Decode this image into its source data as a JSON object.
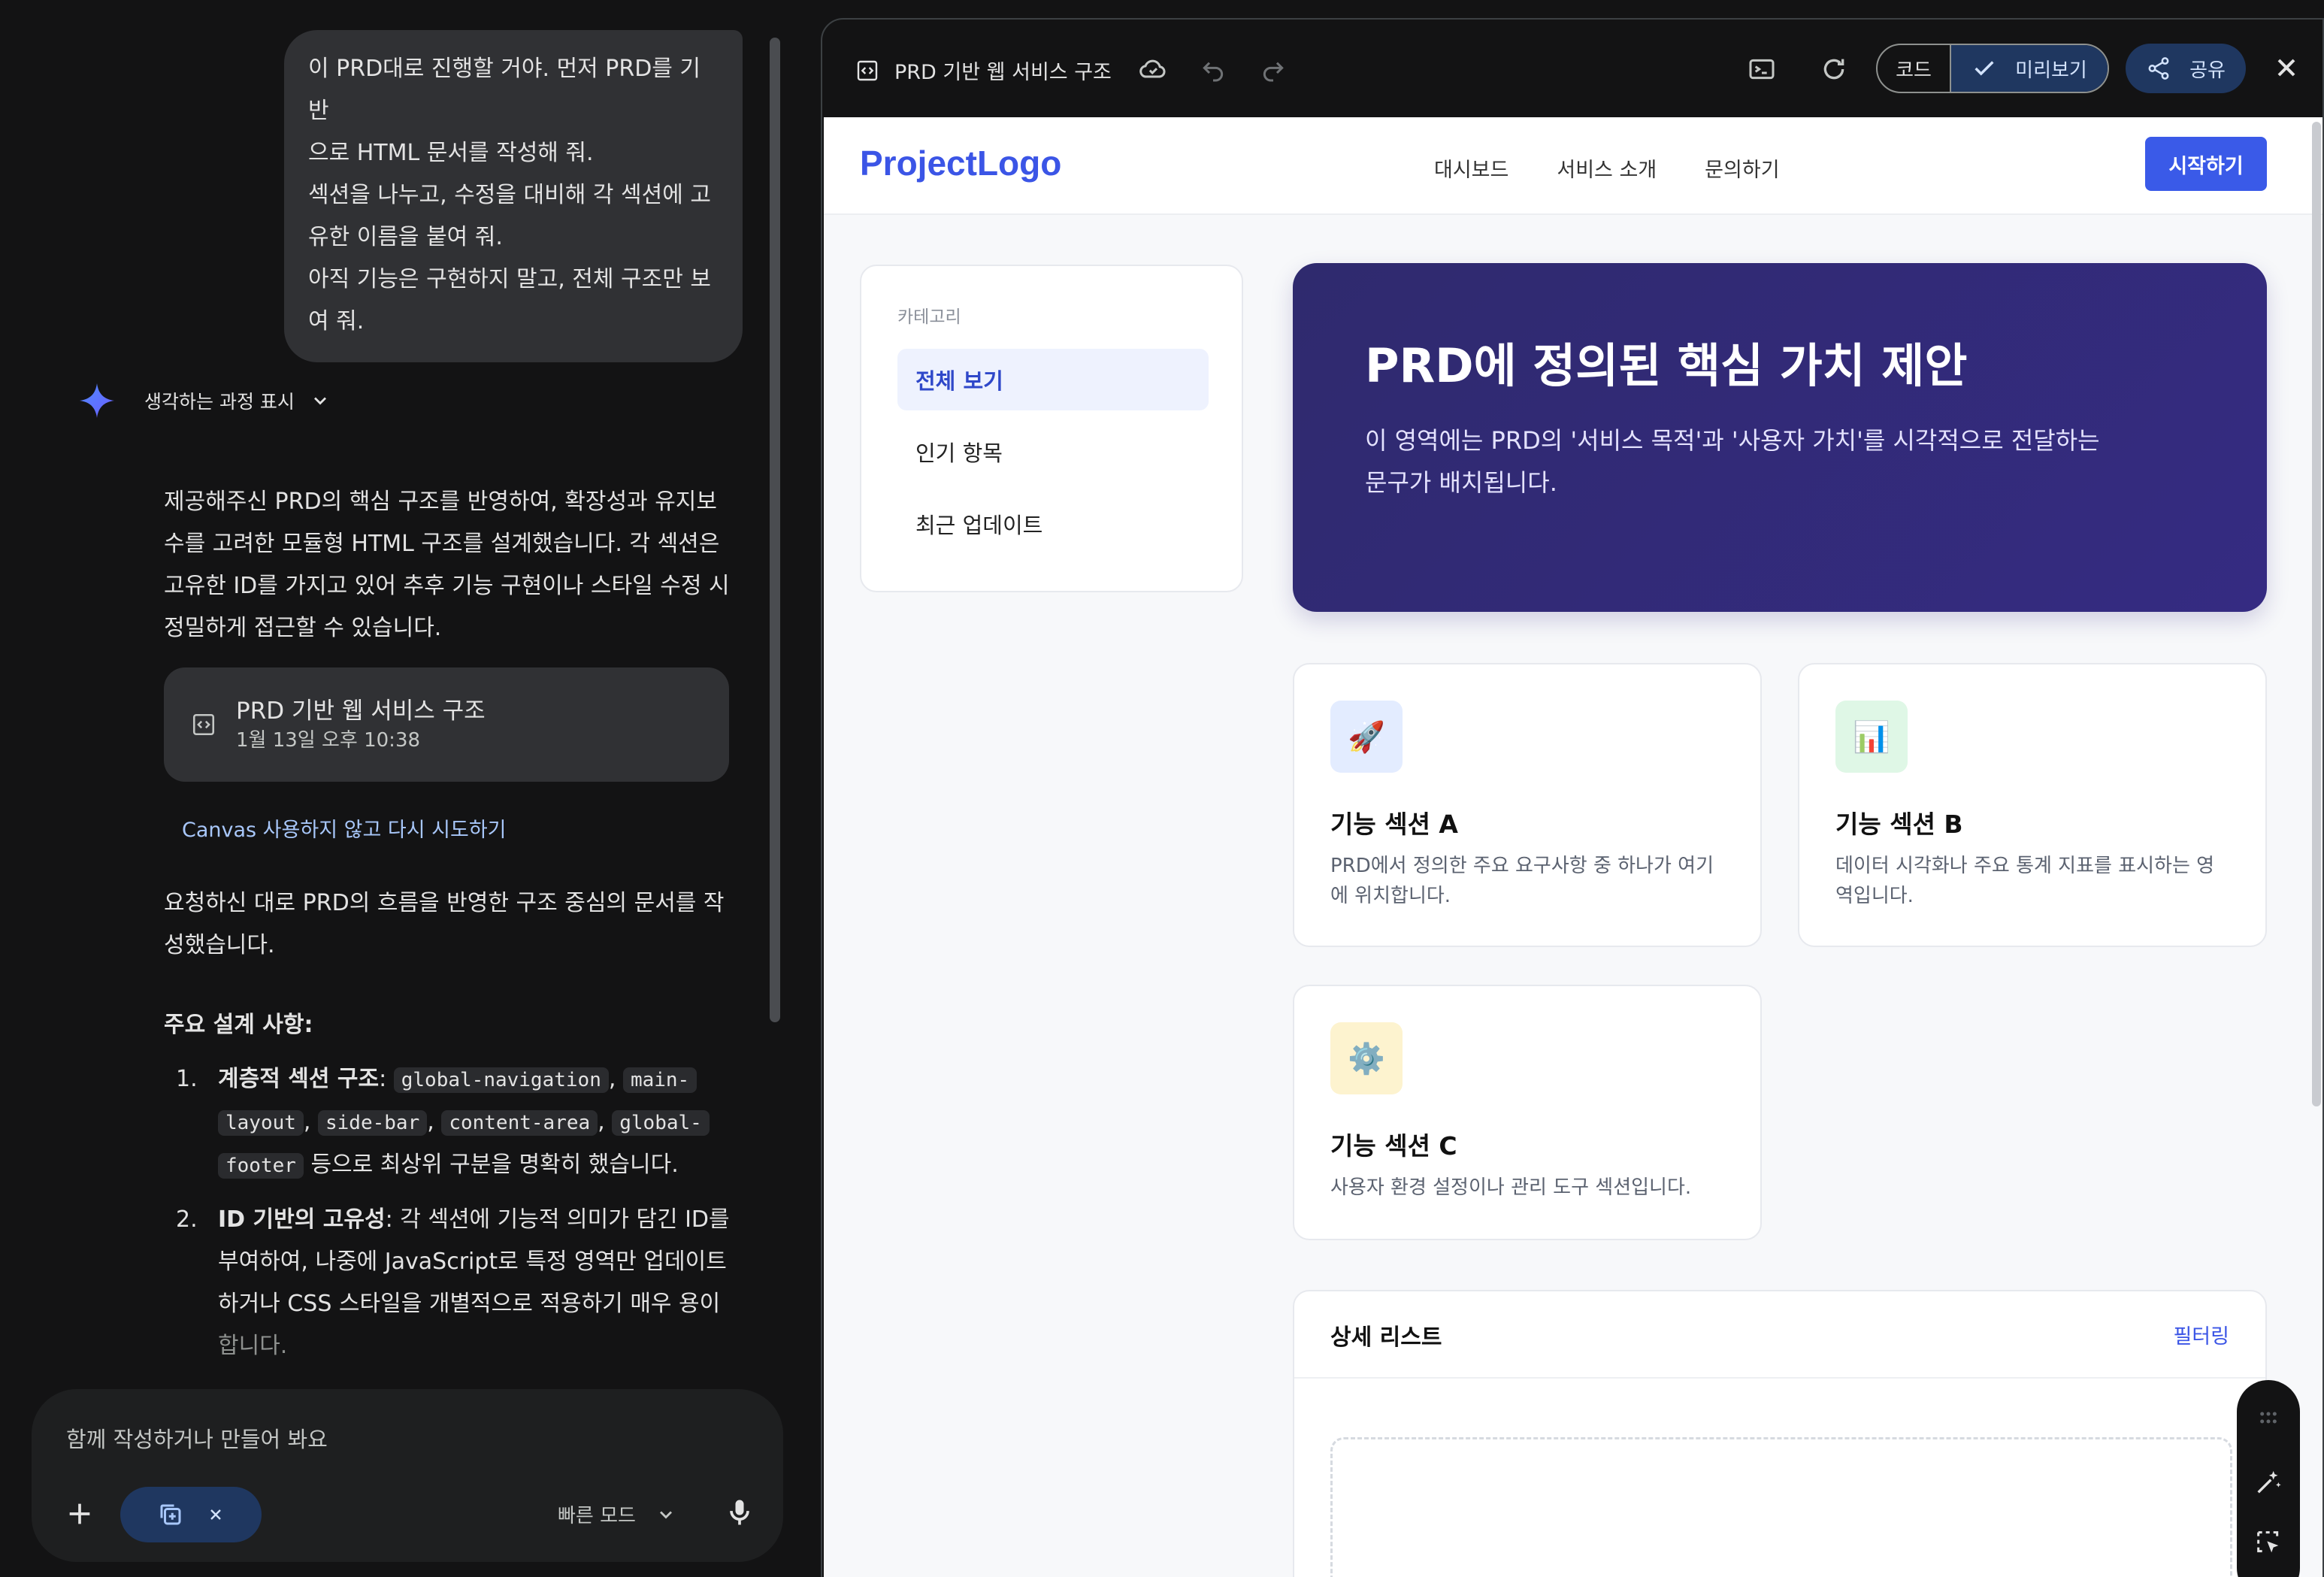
{
  "chat": {
    "user_message": [
      "이 PRD대로 진행할 거야. 먼저 PRD를 기반",
      "으로 HTML 문서를 작성해 줘.",
      "섹션을 나누고, 수정을 대비해 각 섹션에 고",
      "유한 이름을 붙여 줘.",
      "아직 기능은 구현하지 말고, 전체 구조만 보",
      "여 줘."
    ],
    "thinking_label": "생각하는 과정 표시",
    "response_intro": [
      "제공해주신 PRD의 핵심 구조를 반영하여, 확장성과 유지보",
      "수를 고려한 모듈형 HTML 구조를 설계했습니다. 각 섹션은",
      "고유한 ID를 가지고 있어 추후 기능 구현이나 스타일 수정 시",
      "정밀하게 접근할 수 있습니다."
    ],
    "doc_card": {
      "title": "PRD 기반 웹 서비스 구조",
      "timestamp": "1월 13일 오후 10:38"
    },
    "retry_link": "Canvas 사용하지 않고 다시 시도하기",
    "response_2": [
      "요청하신 대로 PRD의 흐름을 반영한 구조 중심의 문서를 작",
      "성했습니다."
    ],
    "design_title": "주요 설계 사항:",
    "list": {
      "item1": {
        "num": "1.",
        "bold": "계층적 섹션 구조",
        "colon": ": ",
        "code1": "global-navigation",
        "code2a": "main-",
        "code2b": "layout",
        "code3": "side-bar",
        "code4": "content-area",
        "code5a": "global-",
        "code5b": "footer",
        "sep": ", ",
        "tail": " 등으로 최상위 구분을 명확히 했습니다."
      },
      "item2": {
        "num": "2.",
        "bold": "ID 기반의 고유성",
        "line1": ": 각 섹션에 기능적 의미가 담긴 ID를",
        "line2": "부여하여, 나중에 JavaScript로 특정 영역만 업데이트",
        "line3": "하거나 CSS 스타일을 개별적으로 적용하기 매우 용이",
        "line4": "합니다."
      }
    },
    "composer": {
      "placeholder": "함께 작성하거나 만들어 봐요",
      "mode": "빠른 모드"
    }
  },
  "canvas": {
    "title": "PRD 기반 웹 서비스 구조",
    "code_label": "코드",
    "preview_label": "미리보기",
    "share_label": "공유"
  },
  "preview": {
    "logo": "ProjectLogo",
    "nav": [
      "대시보드",
      "서비스 소개",
      "문의하기"
    ],
    "cta": "시작하기",
    "sidebar": {
      "heading": "카테고리",
      "items": [
        "전체 보기",
        "인기 항목",
        "최근 업데이트"
      ]
    },
    "hero": {
      "title": "PRD에 정의된 핵심 가치 제안",
      "desc1": "이 영역에는 PRD의 '서비스 목적'과 '사용자 가치'를 시각적으로 전달하는",
      "desc2": "문구가 배치됩니다."
    },
    "features": [
      {
        "icon": "🚀",
        "title": "기능 섹션 A",
        "desc1": "PRD에서 정의한 주요 요구사항 중 하나가 여기",
        "desc2": "에 위치합니다.",
        "icon_bg": "#e3ecff"
      },
      {
        "icon": "📊",
        "title": "기능 섹션 B",
        "desc1": "데이터 시각화나 주요 통계 지표를 표시하는 영",
        "desc2": "역입니다.",
        "icon_bg": "#dff7e6"
      },
      {
        "icon": "⚙️",
        "title": "기능 섹션 C",
        "desc1": "사용자 환경 설정이나 관리 도구 섹션입니다.",
        "desc2": "",
        "icon_bg": "#fdf3cf"
      }
    ],
    "list_card": {
      "title": "상세 리스트",
      "filter": "필터링"
    }
  }
}
